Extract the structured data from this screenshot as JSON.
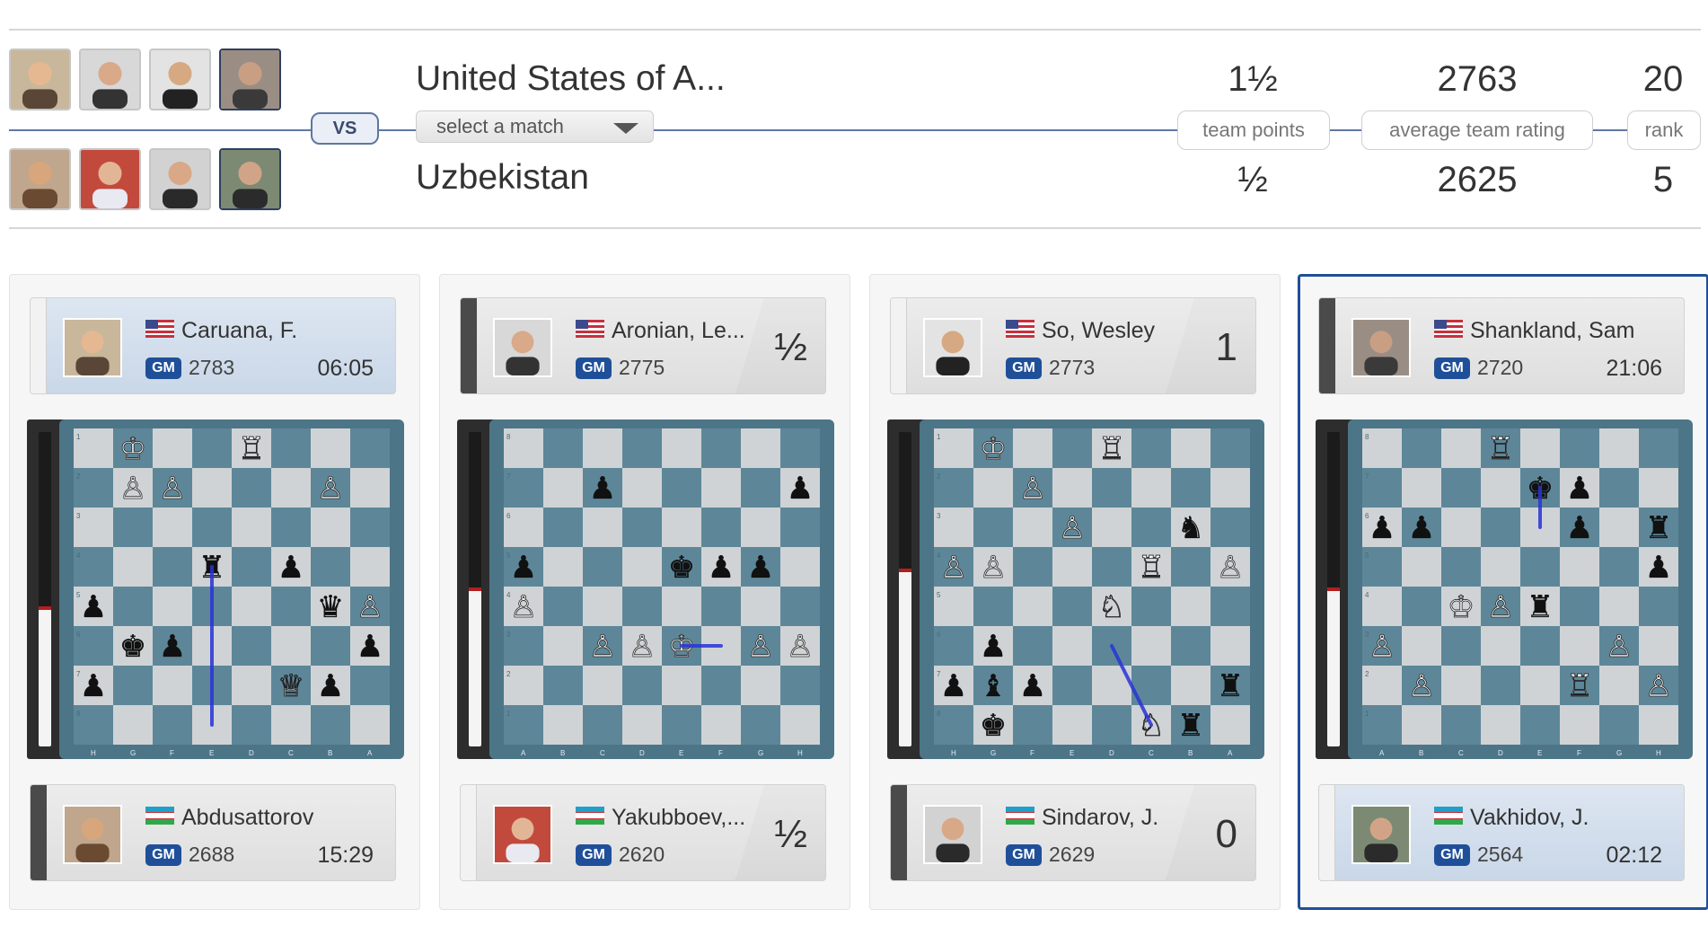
{
  "teams": {
    "top": {
      "name": "United States of A...",
      "team_points": "1½",
      "average_team_rating": "2763",
      "rank": "20"
    },
    "bottom": {
      "name": "Uzbekistan",
      "team_points": "½",
      "average_team_rating": "2625",
      "rank": "5"
    }
  },
  "vs_label": "VS",
  "select_match": {
    "label": "select a match"
  },
  "stat_labels": {
    "team_points": "team points",
    "average_team_rating": "average team rating",
    "rank": "rank"
  },
  "colors": {
    "accent": "#1f4f99",
    "board_dark": "#5d8799",
    "board_light": "#d0d3d5",
    "arrow": "#2a33d8",
    "eval_marker": "#b21f1f"
  },
  "boards": [
    {
      "top": {
        "name": "Caruana, F.",
        "flag": "usa-flag",
        "title": "GM",
        "rating": "2783",
        "clock": "06:05",
        "score": ""
      },
      "bottom": {
        "name": "Abdusattorov",
        "flag": "uzbekistan-flag",
        "title": "GM",
        "rating": "2688",
        "clock": "15:29",
        "score": ""
      },
      "eval_white_fraction": 0.44,
      "files": [
        "H",
        "G",
        "F",
        "E",
        "D",
        "C",
        "B",
        "A"
      ],
      "ranks": [
        "1",
        "2",
        "3",
        "4",
        "5",
        "6",
        "7",
        "8"
      ],
      "pieces": [
        [
          "",
          "♔",
          "",
          "",
          "♖",
          "",
          "",
          ""
        ],
        [
          "",
          "♙",
          "♙",
          "",
          "",
          "",
          "♙",
          ""
        ],
        [
          "",
          "",
          "",
          "",
          "",
          "",
          "",
          ""
        ],
        [
          "",
          "",
          "",
          "♜",
          "",
          "♟",
          "",
          ""
        ],
        [
          "♟",
          "",
          "",
          "",
          "",
          "",
          "♛",
          "♙"
        ],
        [
          "",
          "♚",
          "♟",
          "",
          "",
          "",
          "",
          "♟"
        ],
        [
          "♟",
          "",
          "",
          "",
          "",
          "♕",
          "♟",
          ""
        ],
        [
          "",
          "",
          "",
          "",
          "",
          "",
          "",
          ""
        ]
      ],
      "last_move": {
        "from": "E4",
        "to": "E8"
      }
    },
    {
      "top": {
        "name": "Aronian, Le...",
        "flag": "usa-flag",
        "title": "GM",
        "rating": "2775",
        "clock": "",
        "score": "½"
      },
      "bottom": {
        "name": "Yakubboev,...",
        "flag": "uzbekistan-flag",
        "title": "GM",
        "rating": "2620",
        "clock": "",
        "score": "½"
      },
      "eval_white_fraction": 0.5,
      "files": [
        "A",
        "B",
        "C",
        "D",
        "E",
        "F",
        "G",
        "H"
      ],
      "ranks": [
        "8",
        "7",
        "6",
        "5",
        "4",
        "3",
        "2",
        "1"
      ],
      "pieces": [
        [
          "",
          "",
          "",
          "",
          "",
          "",
          "",
          ""
        ],
        [
          "",
          "",
          "♟",
          "",
          "",
          "",
          "",
          "♟"
        ],
        [
          "",
          "",
          "",
          "",
          "",
          "",
          "",
          ""
        ],
        [
          "♟",
          "",
          "",
          "",
          "♚",
          "♟",
          "♟",
          ""
        ],
        [
          "♙",
          "",
          "",
          "",
          "",
          "",
          "",
          ""
        ],
        [
          "",
          "",
          "♙",
          "♙",
          "♔",
          "",
          "♙",
          "♙"
        ],
        [
          "",
          "",
          "",
          "",
          "",
          "",
          "",
          ""
        ],
        [
          "",
          "",
          "",
          "",
          "",
          "",
          "",
          ""
        ]
      ],
      "last_move": {
        "from": "F3",
        "to": "E3"
      }
    },
    {
      "top": {
        "name": "So, Wesley",
        "flag": "usa-flag",
        "title": "GM",
        "rating": "2773",
        "clock": "",
        "score": "1"
      },
      "bottom": {
        "name": "Sindarov, J.",
        "flag": "uzbekistan-flag",
        "title": "GM",
        "rating": "2629",
        "clock": "",
        "score": "0"
      },
      "eval_white_fraction": 0.56,
      "files": [
        "H",
        "G",
        "F",
        "E",
        "D",
        "C",
        "B",
        "A"
      ],
      "ranks": [
        "1",
        "2",
        "3",
        "4",
        "5",
        "6",
        "7",
        "8"
      ],
      "pieces": [
        [
          "",
          "♔",
          "",
          "",
          "♖",
          "",
          "",
          ""
        ],
        [
          "",
          "",
          "♙",
          "",
          "",
          "",
          "",
          ""
        ],
        [
          "",
          "",
          "",
          "♙",
          "",
          "",
          "♞",
          ""
        ],
        [
          "♙",
          "♙",
          "",
          "",
          "",
          "♖",
          "",
          "♙"
        ],
        [
          "",
          "",
          "",
          "",
          "♘",
          "",
          "",
          ""
        ],
        [
          "",
          "♟",
          "",
          "",
          "",
          "",
          "",
          ""
        ],
        [
          "♟",
          "♝",
          "♟",
          "",
          "",
          "",
          "",
          "♜"
        ],
        [
          "",
          "♚",
          "",
          "",
          "",
          "♘",
          "♜",
          ""
        ]
      ],
      "last_move": {
        "from": "D6",
        "to": "C8"
      }
    },
    {
      "top": {
        "name": "Shankland, Sam",
        "flag": "usa-flag",
        "title": "GM",
        "rating": "2720",
        "clock": "21:06",
        "score": ""
      },
      "bottom": {
        "name": "Vakhidov, J.",
        "flag": "uzbekistan-flag",
        "title": "GM",
        "rating": "2564",
        "clock": "02:12",
        "score": ""
      },
      "eval_white_fraction": 0.5,
      "files": [
        "A",
        "B",
        "C",
        "D",
        "E",
        "F",
        "G",
        "H"
      ],
      "ranks": [
        "8",
        "7",
        "6",
        "5",
        "4",
        "3",
        "2",
        "1"
      ],
      "pieces": [
        [
          "",
          "",
          "",
          "♖",
          "",
          "",
          "",
          ""
        ],
        [
          "",
          "",
          "",
          "",
          "♚",
          "♟",
          "",
          ""
        ],
        [
          "♟",
          "♟",
          "",
          "",
          "",
          "♟",
          "",
          "♜"
        ],
        [
          "",
          "",
          "",
          "",
          "",
          "",
          "",
          "♟"
        ],
        [
          "",
          "",
          "♔",
          "♙",
          "♜",
          "",
          "",
          ""
        ],
        [
          "♙",
          "",
          "",
          "",
          "",
          "",
          "♙",
          ""
        ],
        [
          "",
          "♙",
          "",
          "",
          "",
          "♖",
          "",
          "♙"
        ],
        [
          "",
          "",
          "",
          "",
          "",
          "",
          "",
          ""
        ]
      ],
      "last_move": {
        "from": "E6",
        "to": "E7"
      }
    }
  ]
}
